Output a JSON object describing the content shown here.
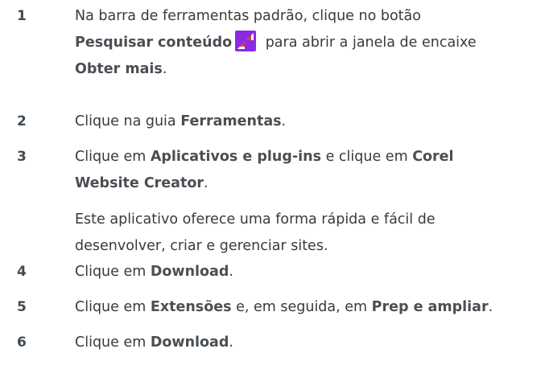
{
  "steps": [
    {
      "number": "1",
      "line1": "Na barra de ferramentas padrão, clique no botão",
      "line2_bold": "Pesquisar conteúdo",
      "line2_icon": "search-content-icon",
      "line2_rest": " para abrir a janela de encaixe",
      "line3_bold": "Obter mais",
      "line3_rest": "."
    },
    {
      "number": "2",
      "pre": "Clique na guia ",
      "bold": "Ferramentas",
      "post": "."
    },
    {
      "number": "3",
      "pre": "Clique em ",
      "bold1": "Aplicativos e plug-ins",
      "mid": " e clique em ",
      "bold2a": "Corel",
      "bold2b": "Website Creator",
      "post": ".",
      "note_line1": "Este aplicativo oferece uma forma rápida e fácil de",
      "note_line2": "desenvolver, criar e gerenciar sites."
    },
    {
      "number": "4",
      "pre": "Clique em ",
      "bold": "Download",
      "post": "."
    },
    {
      "number": "5",
      "pre": "Clique em ",
      "bold1": "Extensões",
      "mid": " e, em seguida, em ",
      "bold2": "Prep e ampliar",
      "post": "."
    },
    {
      "number": "6",
      "pre": "Clique em ",
      "bold": "Download",
      "post": "."
    }
  ],
  "colors": {
    "text": "#3a3a3a",
    "icon_bg": "#8a2be2"
  }
}
